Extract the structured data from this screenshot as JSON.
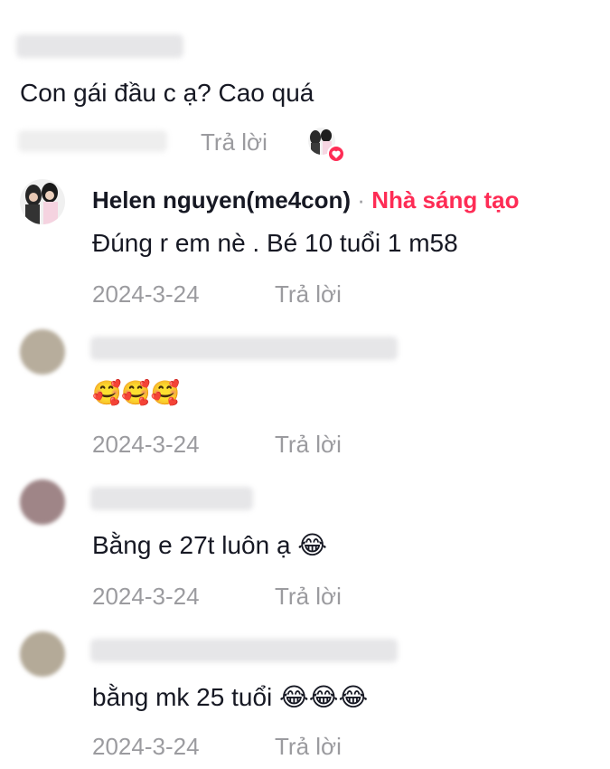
{
  "top_comment": {
    "username": "",
    "text": "Con gái đầu c ạ? Cao quá",
    "date": "",
    "reply_label": "Trả lời"
  },
  "replies": [
    {
      "username": "Helen nguyen(me4con)",
      "separator": "·",
      "badge": "Nhà sáng tạo",
      "text": "Đúng r em nè . Bé 10 tuổi 1 m58",
      "date": "2024-3-24",
      "reply_label": "Trả lời"
    },
    {
      "username": "",
      "text": "🥰🥰🥰",
      "date": "2024-3-24",
      "reply_label": "Trả lời"
    },
    {
      "username": "",
      "text": "Bằng e 27t luôn ạ 😂",
      "date": "2024-3-24",
      "reply_label": "Trả lời"
    },
    {
      "username": "",
      "text": "bằng mk 25 tuổi 😂😂😂",
      "date": "2024-3-24",
      "reply_label": "Trả lời"
    }
  ],
  "colors": {
    "creator_badge": "#fe2c55",
    "meta_text": "#9b9b9f",
    "main_text": "#161823",
    "heart": "#fe2c55"
  },
  "icons": {
    "creator_liked": "heart-icon"
  }
}
